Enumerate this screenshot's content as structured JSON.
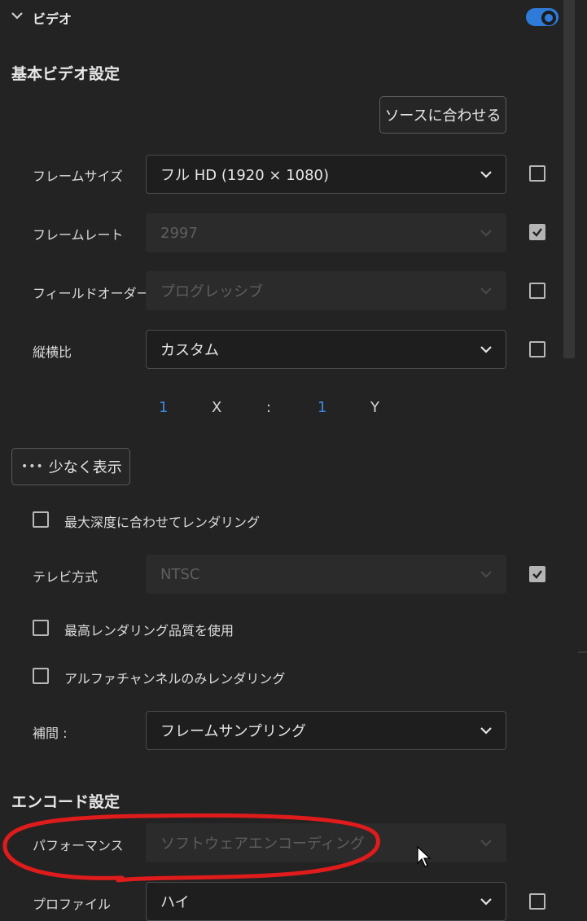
{
  "section": {
    "title": "ビデオ",
    "toggle_on": true
  },
  "basic_video": {
    "heading": "基本ビデオ設定",
    "match_source_button": "ソースに合わせる",
    "frame_size": {
      "label": "フレームサイズ",
      "value": "フル HD (1920 × 1080)"
    },
    "frame_rate": {
      "label": "フレームレート",
      "value": "2997"
    },
    "field_order": {
      "label": "フィールドオーダー",
      "value": "プログレッシブ"
    },
    "aspect": {
      "label": "縦横比",
      "value": "カスタム"
    },
    "ratio": {
      "x_value": "1",
      "x_label": "X",
      "separator": ":",
      "y_value": "1",
      "y_label": "Y"
    },
    "show_less_button": "少なく表示",
    "render_max_depth": "最大深度に合わせてレンダリング",
    "tv_standard": {
      "label": "テレビ方式",
      "value": "NTSC"
    },
    "max_render_quality": "最高レンダリング品質を使用",
    "alpha_only": "アルファチャンネルのみレンダリング",
    "interpolation": {
      "label": "補間 :",
      "value": "フレームサンプリング"
    }
  },
  "encode": {
    "heading": "エンコード設定",
    "performance": {
      "label": "パフォーマンス",
      "value": "ソフトウェアエンコーディング"
    },
    "profile": {
      "label": "プロファイル",
      "value": "ハイ"
    }
  },
  "colors": {
    "accent": "#2f7bd9",
    "annotation": "#e01b1b"
  }
}
